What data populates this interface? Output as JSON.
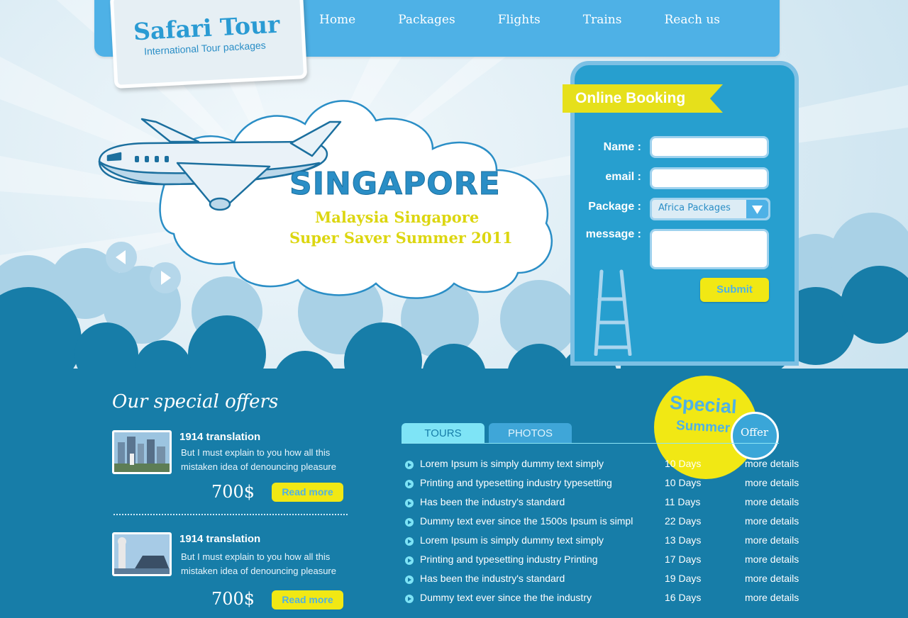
{
  "logo": {
    "title": "Safari Tour",
    "subtitle": "International Tour packages"
  },
  "nav": {
    "items": [
      "Home",
      "Packages",
      "Flights",
      "Trains",
      "Reach  us"
    ]
  },
  "banner": {
    "title": "SINGAPORE",
    "line1": "Malaysia Singapore",
    "line2": "Super Saver Summer 2011"
  },
  "booking": {
    "title": "Online Booking",
    "name_label": "Name :",
    "email_label": "email :",
    "package_label": "Package :",
    "message_label": "message :",
    "package_value": "Africa Packages",
    "submit_label": "Submit"
  },
  "offers": {
    "title": "Our special offers",
    "items": [
      {
        "title": "1914 translation",
        "desc": "But I must explain to you how all this mistaken idea of denouncing pleasure",
        "price": "700$",
        "button": "Read more"
      },
      {
        "title": "1914 translation",
        "desc": "But I must explain to you how all this mistaken idea of denouncing pleasure",
        "price": "700$",
        "button": "Read more"
      }
    ]
  },
  "special": {
    "line1": "Special",
    "line2": "Summer",
    "badge": "Offer"
  },
  "tabs": [
    "TOURS",
    "PHOTOS"
  ],
  "tours": [
    {
      "name": "Lorem Ipsum is simply dummy text simply",
      "days": "10 Days",
      "link": "more details"
    },
    {
      "name": "Printing and typesetting industry typesetting",
      "days": "10 Days",
      "link": "more details"
    },
    {
      "name": "Has been the industry's standard",
      "days": "11 Days",
      "link": "more details"
    },
    {
      "name": "Dummy text ever since the 1500s Ipsum is simpl",
      "days": "22 Days",
      "link": "more details"
    },
    {
      "name": "Lorem Ipsum is simply dummy text simply",
      "days": "13 Days",
      "link": "more details"
    },
    {
      "name": "Printing and typesetting industry Printing",
      "days": "17 Days",
      "link": "more details"
    },
    {
      "name": "Has been the industry's standard",
      "days": "19 Days",
      "link": "more details"
    },
    {
      "name": "Dummy text ever since the the industry",
      "days": "16 Days",
      "link": "more details"
    }
  ],
  "colors": {
    "accent": "#4eb1e6",
    "dark": "#177da8",
    "yellow": "#f1e814"
  }
}
